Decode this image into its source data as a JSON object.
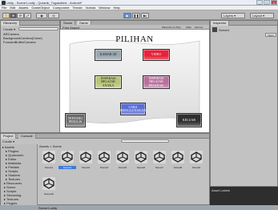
{
  "window": {
    "title": "Unity - Scene1.unity - Quranik_TugasAkhir - Android*"
  },
  "menu": [
    "File",
    "Edit",
    "Assets",
    "GameObject",
    "Component",
    "Terrain",
    "Vuforia",
    "Window",
    "Help"
  ],
  "toolbar": {
    "play_icon": "play-icon",
    "pause_icon": "pause-icon",
    "step_icon": "step-icon",
    "layers_label": "Layers",
    "layout_label": "Layout"
  },
  "hierarchy": {
    "tab": "Hierarchy",
    "create_label": "Create",
    "items": [
      "ARCamera",
      "BackgroundCamera(Clone)",
      "ForwardBuffer/Camera"
    ]
  },
  "scene_tabs": [
    {
      "label": "Scene"
    },
    {
      "label": "Game"
    }
  ],
  "scene_bar": {
    "aspect": "Free Aspect",
    "maximize": "Maximize on Play",
    "stats": "Stats",
    "gizmos": "Gizmos"
  },
  "menu_screen": {
    "title": "PILIHAN",
    "buttons": [
      {
        "id": "kamar",
        "label": "KAMAR 3D",
        "bg": "#9aa6ad"
      },
      {
        "id": "video",
        "label": "VIDEO",
        "bg": "#e4243b"
      },
      {
        "id": "animasi1",
        "label": "INSPIRASI BELAJAR ANAKA",
        "bg": "#b9c47a"
      },
      {
        "id": "animasi2",
        "label": "INSPIRASI BELAJAR PESANAK",
        "bg": "#b86f9c"
      },
      {
        "id": "cara",
        "label": "CARA MENGGUNAKAN",
        "bg": "#5b6ed6"
      },
      {
        "id": "tentang",
        "label": "TENTANG PENULIS",
        "bg": "#6b6b6b"
      },
      {
        "id": "keluar",
        "label": "KELUAR",
        "bg": "#2f2f2f"
      }
    ]
  },
  "inspector": {
    "tab": "Inspector",
    "object": "Scene1",
    "open_label": "Open"
  },
  "project": {
    "tabs": [
      "Project",
      "Console"
    ],
    "create_label": "Create",
    "breadcrumb": "Assets > Scene",
    "tree": [
      "Assets",
      "Plugins",
      "Qualcomm",
      "Editor",
      "Materials",
      "Prefabs",
      "Scripts",
      "Shaders",
      "Textures",
      "Resources",
      "Scene",
      "Scripts",
      "Streaming",
      "Textures",
      "Plugins"
    ],
    "assets": [
      "Scene1",
      "Scene2",
      "Scene3",
      "Scene4",
      "Scene5",
      "Scene6",
      "Scene7",
      "Scene8",
      "Scene9",
      "Scene10"
    ],
    "selected_index": 1
  },
  "asset_labels_title": "Asset Labels",
  "status": {
    "text": "Scene1.unity"
  }
}
